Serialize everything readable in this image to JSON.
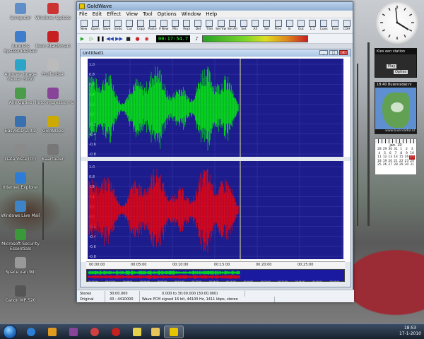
{
  "desktop": {
    "icons_left": [
      {
        "label": "Computer",
        "color": "#5f8fc9"
      },
      {
        "label": "Aurora's Systeembeheer",
        "color": "#3d7dcc"
      },
      {
        "label": "Aurora's Image Viewer 3000",
        "color": "#2aa5c7"
      },
      {
        "label": "Alle Opties",
        "color": "#4a9c4a"
      },
      {
        "label": "EasyBCD 2.0.2",
        "color": "#3970b0"
      },
      {
        "label": "Data Vista (D:)",
        "color": "#8a8a8a"
      },
      {
        "label": "Internet Explorer",
        "color": "#2b7dd6"
      },
      {
        "label": "Windows Live Mail",
        "color": "#3c83c8"
      },
      {
        "label": "Microsoft Security Essentials",
        "color": "#3a9a3a"
      },
      {
        "label": "Space van Wil",
        "color": "#999999"
      },
      {
        "label": "Canon MP 520",
        "color": "#555555"
      }
    ],
    "icons_mid": [
      {
        "label": "Windows Update",
        "color": "#cc3333"
      },
      {
        "label": "Nero StartSmart",
        "color": "#c62020"
      },
      {
        "label": "Prullenbak",
        "color": "#bbbbbb"
      },
      {
        "label": "Photo Impression 6",
        "color": "#884499"
      },
      {
        "label": "GoldWave",
        "color": "#ccaa00"
      },
      {
        "label": "Kaartlezer",
        "color": "#777777"
      }
    ]
  },
  "goldwave": {
    "title": "GoldWave",
    "menu": [
      "File",
      "Edit",
      "Effect",
      "View",
      "Tool",
      "Options",
      "Window",
      "Help"
    ],
    "toolbar": [
      "New",
      "Open",
      "Save",
      "Undo",
      "Cut",
      "Copy",
      "Paste",
      "P.New",
      "Mix",
      "Repl",
      "Del",
      "Trim",
      "Sel Vw",
      "Sel All",
      "Set",
      "All",
      "Sel",
      "Prev",
      "In",
      "Out",
      "1:1",
      "Cues",
      "Eval",
      "CDH"
    ],
    "time_display": "00:17:54.7",
    "document": {
      "title": "Untitled1",
      "scale_left": [
        "1.0",
        "0.8",
        "0.6",
        "0.4",
        "0.2",
        "0.0",
        "-0.2",
        "-0.4",
        "-0.6",
        "-0.8"
      ],
      "ruler": [
        "00:00:00",
        "00:05:00",
        "00:10:00",
        "00:15:00",
        "00:20:00",
        "00:25:00"
      ],
      "overview_ticks": [
        "00:00:00",
        "00:02:00",
        "00:04:00",
        "00:06:00",
        "00:08:00",
        "00:10:00",
        "00:12:00",
        "00:14:00",
        "00:16:00",
        "00:18:00",
        "00:20:00",
        "00:22:00",
        "00:24:00",
        "00:26:00",
        "00:28:00"
      ],
      "channel_colors": {
        "left": "#00ff00",
        "right": "#ff0000",
        "background": "#1c1c8c"
      }
    },
    "status": {
      "row1": [
        "Stereo",
        "30:00.000",
        "0.000 to 30:00.000 (30:00.000)"
      ],
      "row2": [
        "Original",
        "43 : 4410000",
        "Wave PCM signed 16 bit, 44100 Hz, 1411 kbps, stereo"
      ]
    }
  },
  "gadgets": {
    "radio_title": "Kies een station",
    "radio_play": "Play",
    "radio_options": "Opties",
    "weather_title": "18:40 Buienradar.nl",
    "weather_footer": "www.buienradar.nl",
    "calendar_month": "jan. 10",
    "calendar_days": [
      "28",
      "29",
      "30",
      "31",
      "1",
      "2",
      "3",
      "4",
      "5",
      "6",
      "7",
      "8",
      "9",
      "10",
      "11",
      "12",
      "13",
      "14",
      "15",
      "16",
      "17",
      "18",
      "19",
      "20",
      "21",
      "22",
      "23",
      "24",
      "25",
      "26",
      "27",
      "28",
      "29",
      "30",
      "31"
    ],
    "calendar_today": "17"
  },
  "taskbar": {
    "time": "18:53",
    "date": "17-1-2010"
  }
}
